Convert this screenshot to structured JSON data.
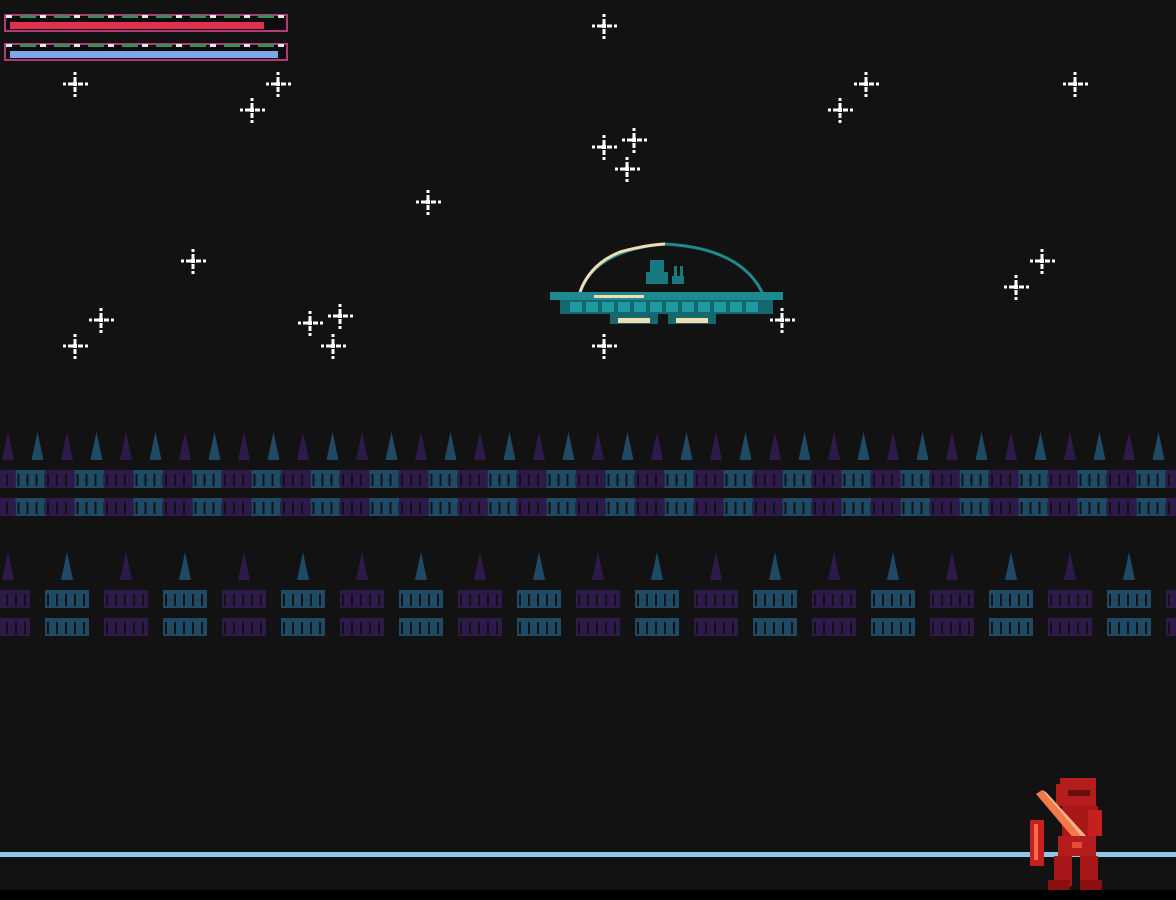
{
  "hud": {
    "health": {
      "level": 0.92,
      "color": "#e0304f",
      "frame_color": "#b03a7a"
    },
    "mana": {
      "level": 0.97,
      "color": "#7fa6e6",
      "frame_color": "#b03a7a"
    }
  },
  "scene": {
    "background_color": "#121212",
    "star_color": "#ffffff",
    "tree_colors": [
      "#2d1a4a",
      "#1f4a66"
    ],
    "ground_line_color": "#8fc7e8",
    "icons": [
      "star-icon",
      "ufo-enemy",
      "knight-player",
      "pine-tree"
    ]
  },
  "entities": {
    "ufo": {
      "hull_color": "#187a80",
      "dome_color": "#1f8a8a",
      "light_color": "#f2dcb0"
    },
    "player": {
      "armor_color": "#b51c1c",
      "highlight_color": "#e84a3a",
      "sword_color": "#f07a4a"
    }
  }
}
